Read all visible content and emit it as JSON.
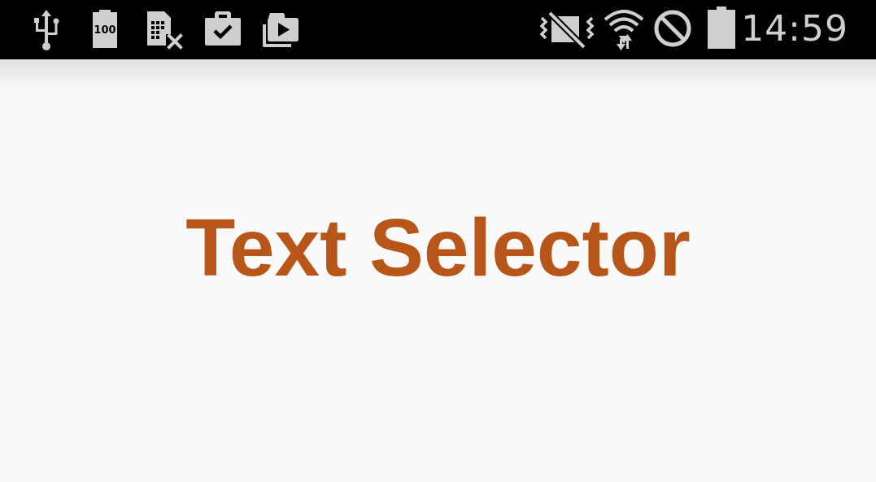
{
  "status_bar": {
    "time": "14:59",
    "battery_saver_level": "100",
    "icon_color": "#cfcfcf",
    "background": "#000000",
    "left_icons": [
      "usb-icon",
      "battery-100-icon",
      "sim-card-missing-icon",
      "work-briefcase-check-icon",
      "video-library-icon"
    ],
    "right_icons": [
      "vibrate-off-icon",
      "wifi-icon",
      "do-not-disturb-icon",
      "battery-icon"
    ]
  },
  "main": {
    "title": "Text Selector",
    "title_color": "#b8561a",
    "background": "#fafafa"
  }
}
